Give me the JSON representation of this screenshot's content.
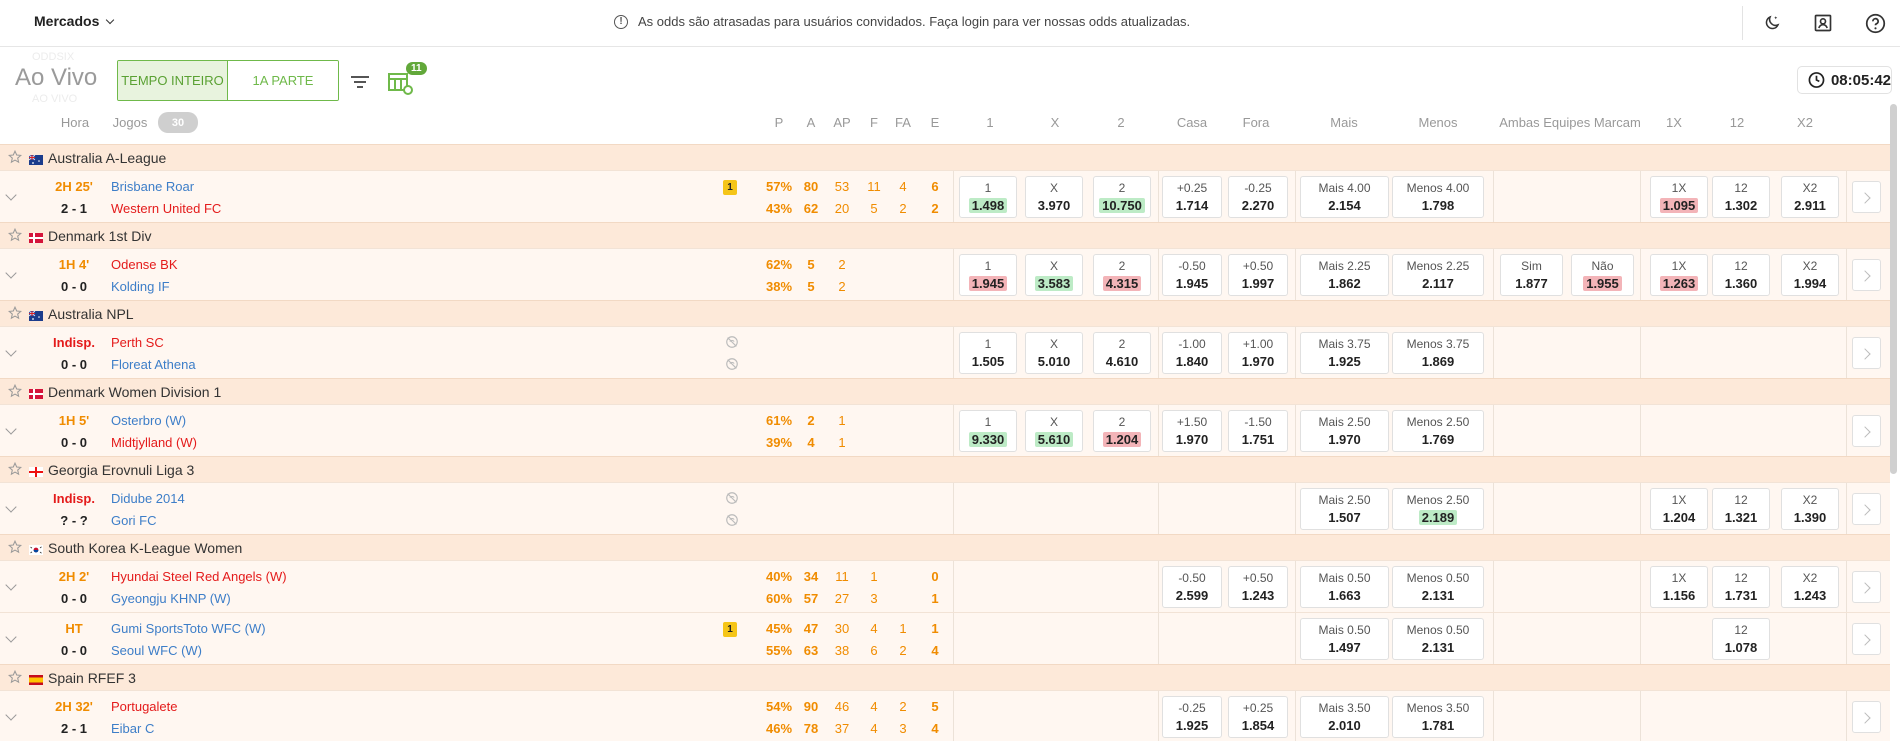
{
  "topbar": {
    "markets_label": "Mercados",
    "notice": "As odds são atrasadas para usuários convidados. Faça login para ver nossas odds atualizadas."
  },
  "controls": {
    "live_title": "Ao Vivo",
    "ghost_top": "ODDSIX",
    "ghost_bottom": "AO VIVO",
    "period_full": "TEMPO INTEIRO",
    "period_half": "1A PARTE",
    "table_badge": "11",
    "clock": "08:05:42"
  },
  "header": {
    "hora": "Hora",
    "jogos": "Jogos",
    "jogos_count": "30",
    "stats": [
      "P",
      "A",
      "AP",
      "F",
      "FA",
      "E"
    ],
    "odds": [
      "1",
      "X",
      "2",
      "Casa",
      "Fora",
      "Mais",
      "Menos",
      "Ambas Equipes Marcam",
      "1X",
      "12",
      "X2"
    ]
  },
  "rows": [
    {
      "type": "league",
      "name": "Australia A-League",
      "flag": "australia"
    },
    {
      "type": "match",
      "time": "2H 25'",
      "time_red": false,
      "score": "2 - 1",
      "home": "Brisbane Roar",
      "home_red": false,
      "away": "Western United FC",
      "away_red": true,
      "card": "1",
      "noinfo": false,
      "stats_top": [
        "57%",
        "80",
        "53",
        "11",
        "4",
        "6"
      ],
      "stats_bot": [
        "43%",
        "62",
        "20",
        "5",
        "2",
        "2"
      ],
      "odds": {
        "1x2": [
          [
            "1",
            "1.498",
            "up"
          ],
          [
            "X",
            "3.970",
            ""
          ],
          [
            "2",
            "10.750",
            "up"
          ]
        ],
        "ah": [
          [
            "+0.25",
            "1.714",
            ""
          ],
          [
            "-0.25",
            "2.270",
            ""
          ]
        ],
        "ou": [
          [
            "Mais 4.00",
            "2.154",
            ""
          ],
          [
            "Menos 4.00",
            "1.798",
            ""
          ]
        ],
        "btts": null,
        "dc": [
          [
            "1X",
            "1.095",
            "down"
          ],
          [
            "12",
            "1.302",
            ""
          ],
          [
            "X2",
            "2.911",
            ""
          ]
        ]
      }
    },
    {
      "type": "league",
      "name": "Denmark 1st Div",
      "flag": "denmark"
    },
    {
      "type": "match",
      "time": "1H 4'",
      "time_red": false,
      "score": "0 - 0",
      "home": "Odense BK",
      "home_red": true,
      "away": "Kolding IF",
      "away_red": false,
      "card": "",
      "noinfo": false,
      "stats_top": [
        "62%",
        "5",
        "2",
        "",
        "",
        ""
      ],
      "stats_bot": [
        "38%",
        "5",
        "2",
        "",
        "",
        ""
      ],
      "odds": {
        "1x2": [
          [
            "1",
            "1.945",
            "down"
          ],
          [
            "X",
            "3.583",
            "up"
          ],
          [
            "2",
            "4.315",
            "down"
          ]
        ],
        "ah": [
          [
            "-0.50",
            "1.945",
            ""
          ],
          [
            "+0.50",
            "1.997",
            ""
          ]
        ],
        "ou": [
          [
            "Mais 2.25",
            "1.862",
            ""
          ],
          [
            "Menos 2.25",
            "2.117",
            ""
          ]
        ],
        "btts": [
          [
            "Sim",
            "1.877",
            ""
          ],
          [
            "Não",
            "1.955",
            "down"
          ]
        ],
        "dc": [
          [
            "1X",
            "1.263",
            "down"
          ],
          [
            "12",
            "1.360",
            ""
          ],
          [
            "X2",
            "1.994",
            ""
          ]
        ]
      }
    },
    {
      "type": "league",
      "name": "Australia NPL",
      "flag": "australia"
    },
    {
      "type": "match",
      "time": "Indisp.",
      "time_red": true,
      "score": "0 - 0",
      "home": "Perth SC",
      "home_red": true,
      "away": "Floreat Athena",
      "away_red": false,
      "card": "",
      "noinfo": true,
      "stats_top": [
        "",
        "",
        "",
        "",
        "",
        ""
      ],
      "stats_bot": [
        "",
        "",
        "",
        "",
        "",
        ""
      ],
      "odds": {
        "1x2": [
          [
            "1",
            "1.505",
            ""
          ],
          [
            "X",
            "5.010",
            ""
          ],
          [
            "2",
            "4.610",
            ""
          ]
        ],
        "ah": [
          [
            "-1.00",
            "1.840",
            ""
          ],
          [
            "+1.00",
            "1.970",
            ""
          ]
        ],
        "ou": [
          [
            "Mais 3.75",
            "1.925",
            ""
          ],
          [
            "Menos 3.75",
            "1.869",
            ""
          ]
        ],
        "btts": null,
        "dc": null
      }
    },
    {
      "type": "league",
      "name": "Denmark Women Division 1",
      "flag": "denmark"
    },
    {
      "type": "match",
      "time": "1H 5'",
      "time_red": false,
      "score": "0 - 0",
      "home": "Osterbro (W)",
      "home_red": false,
      "away": "Midtjylland (W)",
      "away_red": true,
      "card": "",
      "noinfo": false,
      "stats_top": [
        "61%",
        "2",
        "1",
        "",
        "",
        ""
      ],
      "stats_bot": [
        "39%",
        "4",
        "1",
        "",
        "",
        ""
      ],
      "odds": {
        "1x2": [
          [
            "1",
            "9.330",
            "up"
          ],
          [
            "X",
            "5.610",
            "up"
          ],
          [
            "2",
            "1.204",
            "down"
          ]
        ],
        "ah": [
          [
            "+1.50",
            "1.970",
            ""
          ],
          [
            "-1.50",
            "1.751",
            ""
          ]
        ],
        "ou": [
          [
            "Mais 2.50",
            "1.970",
            ""
          ],
          [
            "Menos 2.50",
            "1.769",
            ""
          ]
        ],
        "btts": null,
        "dc": null
      }
    },
    {
      "type": "league",
      "name": "Georgia Erovnuli Liga 3",
      "flag": "georgia"
    },
    {
      "type": "match",
      "time": "Indisp.",
      "time_red": true,
      "score": "? - ?",
      "home": "Didube 2014",
      "home_red": false,
      "away": "Gori FC",
      "away_red": false,
      "card": "",
      "noinfo": true,
      "stats_top": [
        "",
        "",
        "",
        "",
        "",
        ""
      ],
      "stats_bot": [
        "",
        "",
        "",
        "",
        "",
        ""
      ],
      "odds": {
        "1x2": null,
        "ah": null,
        "ou": [
          [
            "Mais 2.50",
            "1.507",
            ""
          ],
          [
            "Menos 2.50",
            "2.189",
            "up"
          ]
        ],
        "btts": null,
        "dc": [
          [
            "1X",
            "1.204",
            ""
          ],
          [
            "12",
            "1.321",
            ""
          ],
          [
            "X2",
            "1.390",
            ""
          ]
        ]
      }
    },
    {
      "type": "league",
      "name": "South Korea K-League Women",
      "flag": "korea"
    },
    {
      "type": "match",
      "time": "2H 2'",
      "time_red": false,
      "score": "0 - 0",
      "home": "Hyundai Steel Red Angels (W)",
      "home_red": true,
      "away": "Gyeongju KHNP (W)",
      "away_red": false,
      "card": "",
      "noinfo": false,
      "stats_top": [
        "40%",
        "34",
        "11",
        "1",
        "",
        "0"
      ],
      "stats_bot": [
        "60%",
        "57",
        "27",
        "3",
        "",
        "1"
      ],
      "odds": {
        "1x2": null,
        "ah": [
          [
            "-0.50",
            "2.599",
            ""
          ],
          [
            "+0.50",
            "1.243",
            ""
          ]
        ],
        "ou": [
          [
            "Mais 0.50",
            "1.663",
            ""
          ],
          [
            "Menos 0.50",
            "2.131",
            ""
          ]
        ],
        "btts": null,
        "dc": [
          [
            "1X",
            "1.156",
            ""
          ],
          [
            "12",
            "1.731",
            ""
          ],
          [
            "X2",
            "1.243",
            ""
          ]
        ]
      }
    },
    {
      "type": "match",
      "time": "HT",
      "time_red": false,
      "score": "0 - 0",
      "home": "Gumi SportsToto WFC (W)",
      "home_red": false,
      "away": "Seoul WFC (W)",
      "away_red": false,
      "card": "1",
      "noinfo": false,
      "stats_top": [
        "45%",
        "47",
        "30",
        "4",
        "1",
        "1"
      ],
      "stats_bot": [
        "55%",
        "63",
        "38",
        "6",
        "2",
        "4"
      ],
      "odds": {
        "1x2": null,
        "ah": null,
        "ou": [
          [
            "Mais 0.50",
            "1.497",
            ""
          ],
          [
            "Menos 0.50",
            "2.131",
            ""
          ]
        ],
        "btts": null,
        "dc": [
          null,
          [
            "12",
            "1.078",
            ""
          ],
          null
        ]
      }
    },
    {
      "type": "league",
      "name": "Spain RFEF 3",
      "flag": "spain"
    },
    {
      "type": "match",
      "time": "2H 32'",
      "time_red": false,
      "score": "2 - 1",
      "home": "Portugalete",
      "home_red": true,
      "away": "Eibar C",
      "away_red": false,
      "card": "",
      "noinfo": false,
      "stats_top": [
        "54%",
        "90",
        "46",
        "4",
        "2",
        "5"
      ],
      "stats_bot": [
        "46%",
        "78",
        "37",
        "4",
        "3",
        "4"
      ],
      "odds": {
        "1x2": null,
        "ah": [
          [
            "-0.25",
            "1.925",
            ""
          ],
          [
            "+0.25",
            "1.854",
            ""
          ]
        ],
        "ou": [
          [
            "Mais 3.50",
            "2.010",
            ""
          ],
          [
            "Menos 3.50",
            "1.781",
            ""
          ]
        ],
        "btts": null,
        "dc": null
      }
    }
  ],
  "colors": {
    "accent_green": "#6fb94a",
    "live_orange": "#f08c00",
    "team_blue": "#3d7ec8",
    "team_red": "#e41b1b",
    "league_bg": "#fde9d9",
    "row_bg": "#fff7f1"
  }
}
